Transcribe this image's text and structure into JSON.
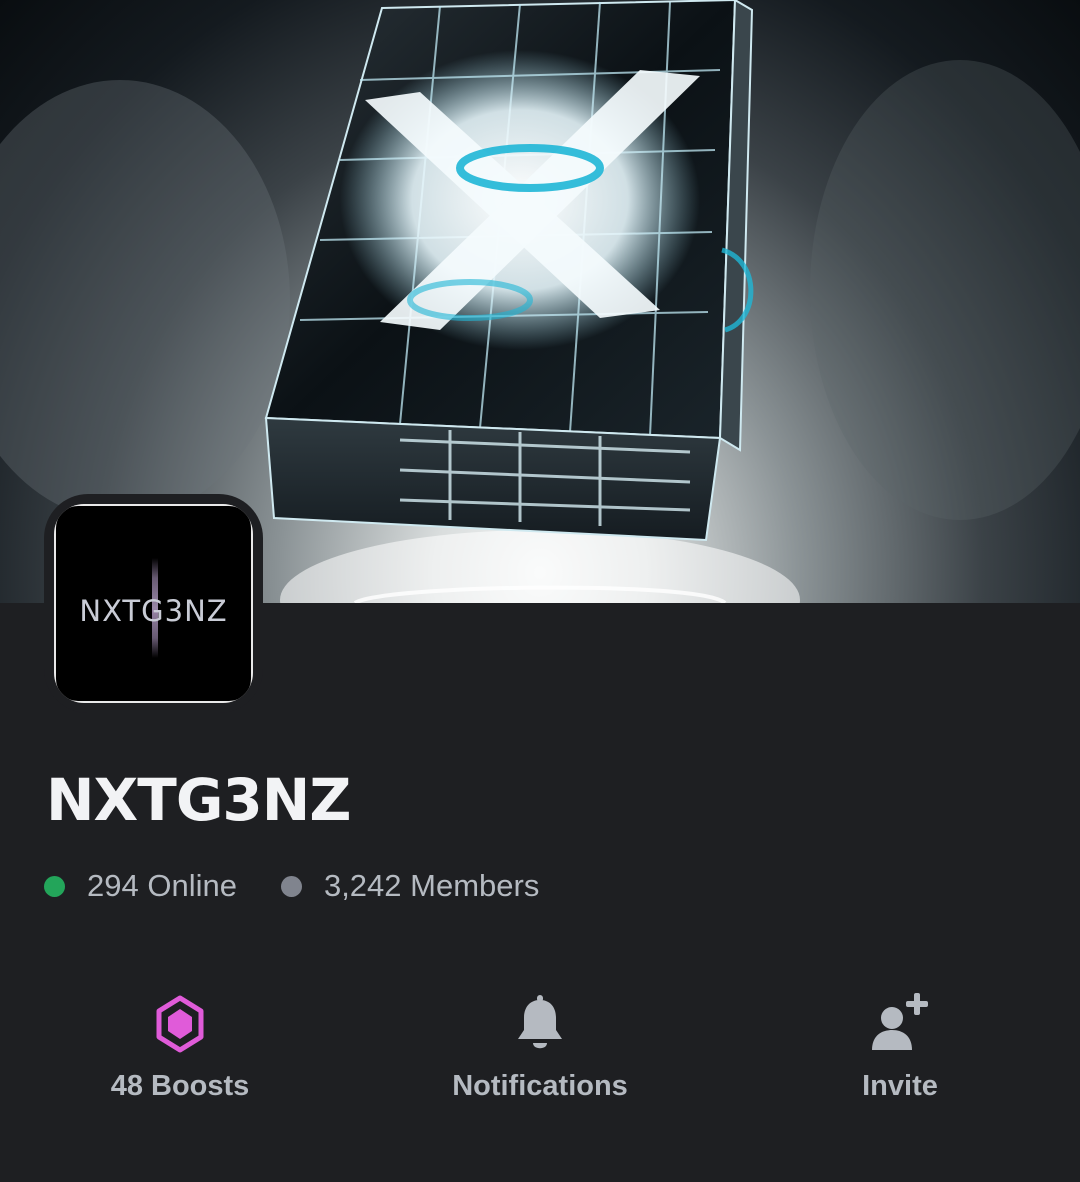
{
  "server": {
    "name": "NXTG3NZ",
    "icon_text": "NXTG3NZ"
  },
  "stats": {
    "online_label": "294 Online",
    "members_label": "3,242 Members"
  },
  "actions": [
    {
      "label": "48 Boosts",
      "icon": "boost-gem-icon"
    },
    {
      "label": "Notifications",
      "icon": "bell-icon"
    },
    {
      "label": "Invite",
      "icon": "add-user-icon"
    }
  ],
  "colors": {
    "background": "#1e1f22",
    "online": "#23a55a",
    "members": "#80848e",
    "boost": "#e05bd9",
    "icon_gray": "#b5bac1",
    "banner_glow": "#1fb6d6"
  }
}
